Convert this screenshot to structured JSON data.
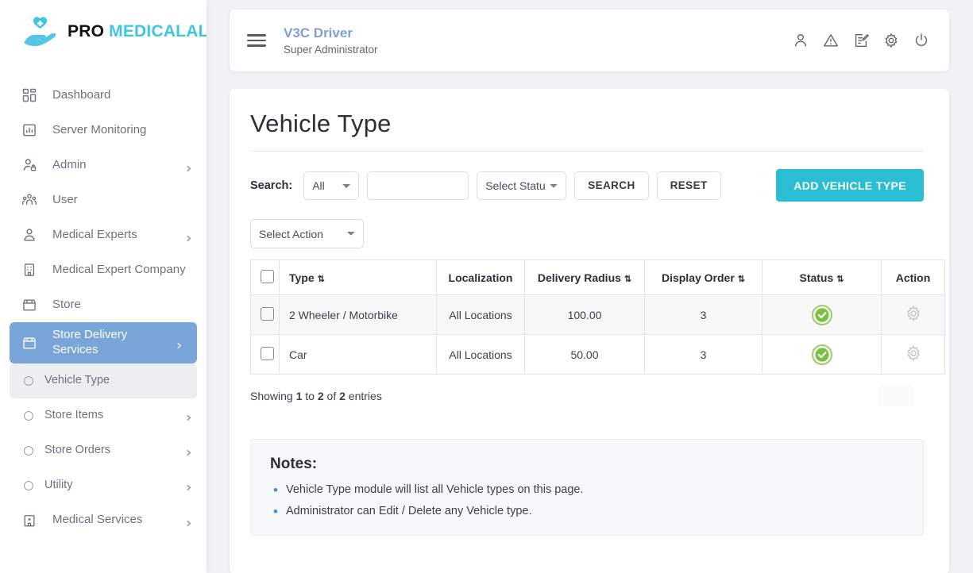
{
  "brand": {
    "pro": "PRO",
    "medicalall": "MEDICALALL",
    "logo_icon": "hand-holding-heart-icon"
  },
  "sidebar": {
    "items": [
      {
        "label": "Dashboard",
        "icon": "dashboard-grid-icon",
        "has_chevron": false
      },
      {
        "label": "Server Monitoring",
        "icon": "chart-bar-icon",
        "has_chevron": false
      },
      {
        "label": "Admin",
        "icon": "user-lock-icon",
        "has_chevron": true
      },
      {
        "label": "User",
        "icon": "users-group-icon",
        "has_chevron": false
      },
      {
        "label": "Medical Experts",
        "icon": "user-tie-icon",
        "has_chevron": true
      },
      {
        "label": "Medical Expert Company",
        "icon": "building-icon",
        "has_chevron": false
      },
      {
        "label": "Store",
        "icon": "store-icon",
        "has_chevron": false
      },
      {
        "label": "Store Delivery Services",
        "icon": "store-icon",
        "has_chevron": true,
        "active": true
      },
      {
        "label": "Vehicle Type",
        "icon": "circle-bullet-icon",
        "sub": true,
        "current": true
      },
      {
        "label": "Store Items",
        "icon": "circle-bullet-icon",
        "sub": true,
        "has_chevron": true
      },
      {
        "label": "Store Orders",
        "icon": "circle-bullet-icon",
        "sub": true,
        "has_chevron": true
      },
      {
        "label": "Utility",
        "icon": "circle-bullet-icon",
        "sub": true,
        "has_chevron": true
      },
      {
        "label": "Medical Services",
        "icon": "hospital-icon",
        "has_chevron": true
      }
    ]
  },
  "topbar": {
    "menu_icon": "hamburger-menu-icon",
    "title": "V3C Driver",
    "subtitle": "Super Administrator",
    "icons": [
      {
        "name": "profile-icon"
      },
      {
        "name": "alert-triangle-icon"
      },
      {
        "name": "edit-document-icon"
      },
      {
        "name": "settings-gear-icon"
      },
      {
        "name": "power-icon"
      }
    ]
  },
  "page": {
    "title": "Vehicle Type",
    "search_label": "Search:",
    "search_scope_value": "All",
    "search_scope_options": [
      "All"
    ],
    "search_text_value": "",
    "search_text_placeholder": "",
    "status_filter_value": "Select Status",
    "status_filter_options": [
      "Select Status"
    ],
    "search_button": "SEARCH",
    "reset_button": "RESET",
    "add_button": "ADD VEHICLE TYPE",
    "action_select_value": "Select Action",
    "action_select_options": [
      "Select Action"
    ],
    "accent_color": "#29bed4",
    "active_nav_color": "#7aa5d8"
  },
  "table": {
    "columns": [
      {
        "key": "checkbox",
        "label": "",
        "sortable": false
      },
      {
        "key": "type",
        "label": "Type",
        "sortable": true
      },
      {
        "key": "localization",
        "label": "Localization",
        "sortable": false
      },
      {
        "key": "delivery_radius",
        "label": "Delivery Radius",
        "sortable": true
      },
      {
        "key": "display_order",
        "label": "Display Order",
        "sortable": true
      },
      {
        "key": "status",
        "label": "Status",
        "sortable": true
      },
      {
        "key": "action",
        "label": "Action",
        "sortable": false
      }
    ],
    "rows": [
      {
        "type": "2 Wheeler / Motorbike",
        "localization": "All Locations",
        "delivery_radius": "100.00",
        "display_order": "3",
        "status": "active",
        "status_icon": "green-check-circle-icon",
        "action_icon": "gear-icon"
      },
      {
        "type": "Car",
        "localization": "All Locations",
        "delivery_radius": "50.00",
        "display_order": "3",
        "status": "active",
        "status_icon": "green-check-circle-icon",
        "action_icon": "gear-icon"
      }
    ],
    "showing_prefix": "Showing ",
    "showing_from": "1",
    "showing_mid1": " to ",
    "showing_to": "2",
    "showing_mid2": " of ",
    "showing_total": "2",
    "showing_suffix": " entries"
  },
  "notes": {
    "title": "Notes:",
    "items": [
      "Vehicle Type module will list all Vehicle types on this page.",
      "Administrator can Edit / Delete any Vehicle type."
    ]
  }
}
